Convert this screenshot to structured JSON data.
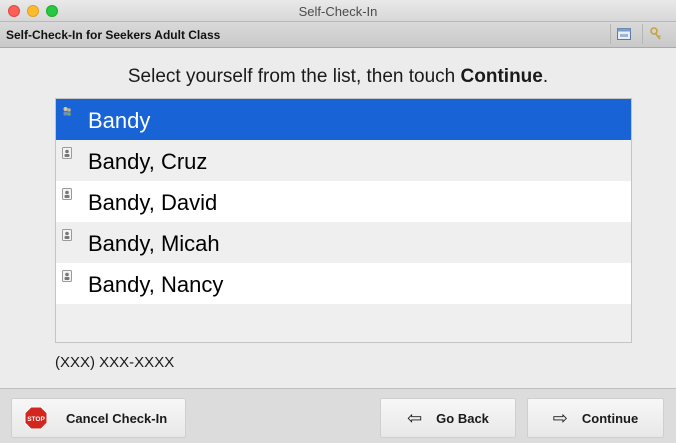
{
  "window": {
    "title": "Self-Check-In"
  },
  "header": {
    "title": "Self-Check-In for Seekers Adult Class"
  },
  "instruction": {
    "prefix": "Select yourself from the list, then touch ",
    "emphasis": "Continue",
    "suffix": "."
  },
  "list": {
    "items": [
      {
        "label": "Bandy",
        "icon": "family-icon",
        "selected": true
      },
      {
        "label": "Bandy, Cruz",
        "icon": "person-icon",
        "selected": false
      },
      {
        "label": "Bandy, David",
        "icon": "person-icon",
        "selected": false
      },
      {
        "label": "Bandy, Micah",
        "icon": "person-icon",
        "selected": false
      },
      {
        "label": "Bandy, Nancy",
        "icon": "person-icon",
        "selected": false
      }
    ]
  },
  "phone": "(XXX) XXX-XXXX",
  "footer": {
    "cancel_label": "Cancel Check-In",
    "cancel_icon_text": "STOP",
    "back_label": "Go Back",
    "continue_label": "Continue"
  },
  "colors": {
    "selection": "#1864d6",
    "stop": "#d2261e"
  }
}
